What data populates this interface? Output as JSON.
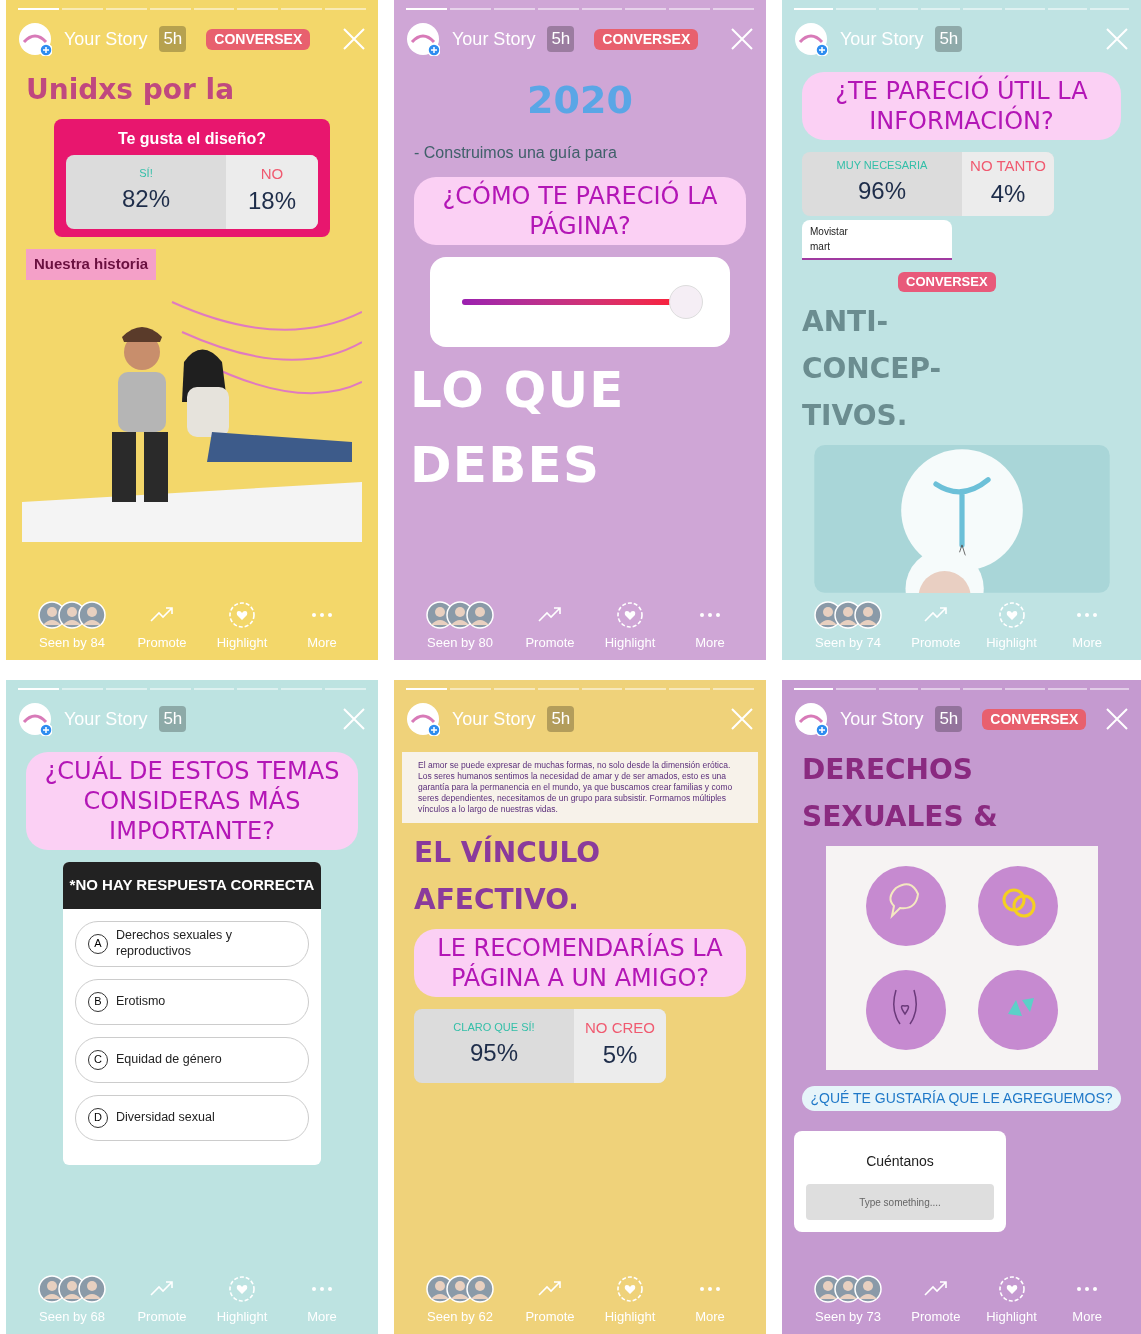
{
  "stories": [
    {
      "title": "Your Story",
      "age": "5h",
      "logo": "CONVERSEX",
      "seen_by": "Seen by 84",
      "actions": [
        "Promote",
        "Highlight",
        "More"
      ],
      "blocks": [
        {
          "kind": "heading",
          "lines": [
            "Unidxs por la"
          ]
        },
        {
          "kind": "poll",
          "question": "Te gusta el diseño?",
          "options": [
            {
              "label": "SÍ!",
              "percent": "82%"
            },
            {
              "label": "NO",
              "percent": "18%"
            }
          ]
        },
        {
          "kind": "tag",
          "text": "Nuestra historia"
        },
        {
          "kind": "picture"
        }
      ]
    },
    {
      "title": "Your Story",
      "age": "5h",
      "logo": "CONVERSEX",
      "seen_by": "Seen by 80",
      "actions": [
        "Promote",
        "Highlight",
        "More"
      ],
      "blocks": [
        {
          "kind": "year",
          "text": "2020"
        },
        {
          "kind": "paragraph",
          "text": "- Construimos una guía para"
        },
        {
          "kind": "question",
          "text": "¿CÓMO TE PARECIÓ LA PÁGINA?"
        },
        {
          "kind": "slider",
          "level": 0.95
        },
        {
          "kind": "heading",
          "lines": [
            "LO QUE",
            "DEBES"
          ]
        }
      ]
    },
    {
      "title": "Your Story",
      "age": "5h",
      "seen_by": "Seen by 74",
      "actions": [
        "Promote",
        "Highlight",
        "More"
      ],
      "blocks": [
        {
          "kind": "question",
          "text": "¿TE PARECIÓ ÚTIL LA INFORMACIÓN?"
        },
        {
          "kind": "poll",
          "options": [
            {
              "label": "MUY NECESARIA",
              "percent": "96%"
            },
            {
              "label": "NO TANTO",
              "percent": "4%"
            }
          ]
        },
        {
          "kind": "snippet",
          "lines": [
            "Movistar",
            "mart"
          ]
        },
        {
          "kind": "logo",
          "text": "CONVERSEX"
        },
        {
          "kind": "heading",
          "lines": [
            "ANTI-",
            "CONCEP-",
            "TIVOS."
          ]
        },
        {
          "kind": "picture"
        }
      ]
    },
    {
      "title": "Your Story",
      "age": "5h",
      "seen_by": "Seen by 68",
      "actions": [
        "Promote",
        "Highlight",
        "More"
      ],
      "blocks": [
        {
          "kind": "question",
          "text": "¿CUÁL DE ESTOS TEMAS CONSIDERAS MÁS IMPORTANTE?"
        },
        {
          "kind": "quiz",
          "title": "*NO HAY RESPUESTA CORRECTA",
          "options": [
            {
              "letter": "A",
              "label": "Derechos sexuales y reproductivos"
            },
            {
              "letter": "B",
              "label": "Erotismo"
            },
            {
              "letter": "C",
              "label": "Equidad de género"
            },
            {
              "letter": "D",
              "label": "Diversidad sexual"
            }
          ]
        }
      ]
    },
    {
      "title": "Your Story",
      "age": "5h",
      "seen_by": "Seen by 62",
      "actions": [
        "Promote",
        "Highlight",
        "More"
      ],
      "blocks": [
        {
          "kind": "paragraph",
          "text": "El amor se puede expresar de muchas formas, no solo desde la dimensión erótica. Los seres humanos sentimos la necesidad de amar y de ser amados, esto es una garantía para la permanencia en el mundo, ya que buscamos crear familias y como seres dependientes, necesitamos de un grupo para subsistir. Formamos múltiples vínculos a lo largo de nuestras vidas."
        },
        {
          "kind": "heading",
          "lines": [
            "EL VÍNCULO",
            "AFECTIVO."
          ]
        },
        {
          "kind": "question",
          "text": "LE RECOMENDARÍAS LA PÁGINA A UN AMIGO?"
        },
        {
          "kind": "poll",
          "options": [
            {
              "label": "CLARO QUE SÍ!",
              "percent": "95%"
            },
            {
              "label": "NO CREO",
              "percent": "5%"
            }
          ]
        }
      ]
    },
    {
      "title": "Your Story",
      "age": "5h",
      "logo": "CONVERSEX",
      "seen_by": "Seen by 73",
      "actions": [
        "Promote",
        "Highlight",
        "More"
      ],
      "blocks": [
        {
          "kind": "heading",
          "lines": [
            "DERECHOS",
            "SEXUALES &"
          ]
        },
        {
          "kind": "icon_grid"
        },
        {
          "kind": "question_box",
          "question": "¿QUÉ TE GUSTARÍA QUE LE AGREGUEMOS?",
          "prompt": "Cuéntanos",
          "placeholder": "Type something...."
        }
      ]
    }
  ]
}
